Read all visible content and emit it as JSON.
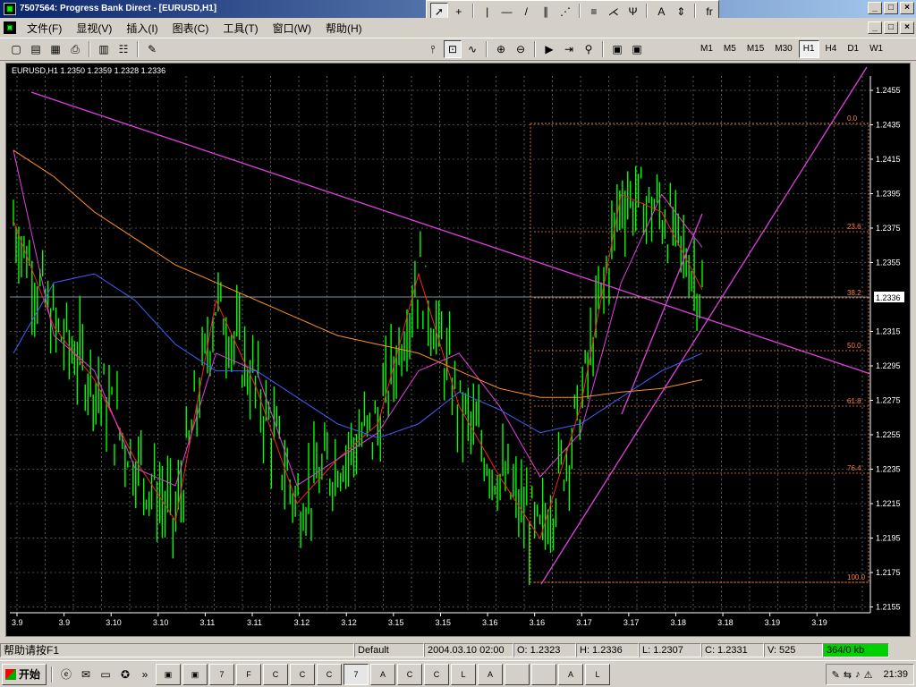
{
  "window": {
    "title": "7507564: Progress Bank Direct - [EURUSD,H1]",
    "btn_min": "_",
    "btn_max": "□",
    "btn_close": "×"
  },
  "menu": [
    "文件(F)",
    "显视(V)",
    "插入(I)",
    "图表(C)",
    "工具(T)",
    "窗口(W)",
    "帮助(H)"
  ],
  "drawing_tools": {
    "text_tool": "A",
    "fib_tool": "fr"
  },
  "timeframes": [
    "M1",
    "M5",
    "M15",
    "M30",
    "H1",
    "H4",
    "D1",
    "W1"
  ],
  "active_timeframe": "H1",
  "chart": {
    "header": "EURUSD,H1  1.2350 1.2359 1.2328 1.2336",
    "current_price": "1.2336",
    "price_labels": [
      "1.2455",
      "1.2435",
      "1.2415",
      "1.2395",
      "1.2375",
      "1.2355",
      "1.2336",
      "1.2315",
      "1.2295",
      "1.2275",
      "1.2255",
      "1.2235",
      "1.2215",
      "1.2195",
      "1.2175",
      "1.2155"
    ],
    "date_labels": [
      "3.9",
      "3.9",
      "3.10",
      "3.10",
      "3.11",
      "3.11",
      "3.12",
      "3.12",
      "3.15",
      "3.15",
      "3.16",
      "3.16",
      "3.17",
      "3.17",
      "3.18",
      "3.18",
      "3.19",
      "3.19"
    ],
    "fib_levels": [
      "0.0",
      "23.6",
      "38.2",
      "50.0",
      "61.8",
      "76.4",
      "100.0"
    ],
    "colors": {
      "bg": "#000000",
      "candle": "#00ff00",
      "grid": "#d0d0d0",
      "trendline": "#e040e0",
      "ma_fast": "#ff2020",
      "ma_mid": "#e040e0",
      "ma_slow": "#4060ff",
      "ma_long": "#ff9020",
      "fib": "#ff8040",
      "price_line": "#8090a0"
    }
  },
  "chart_data": {
    "type": "line",
    "title": "EURUSD,H1  1.2350 1.2359 1.2328 1.2336",
    "xlabel": "",
    "ylabel": "",
    "ylim": [
      1.2155,
      1.2455
    ],
    "categories": [
      "3.9",
      "3.9",
      "3.10",
      "3.10",
      "3.11",
      "3.11",
      "3.12",
      "3.12",
      "3.15",
      "3.15",
      "3.16",
      "3.16",
      "3.17",
      "3.17",
      "3.18",
      "3.18",
      "3.19",
      "3.19"
    ],
    "series": [
      {
        "values": [
          1.2375,
          1.2315,
          1.2285,
          1.224,
          1.2205,
          1.233,
          1.228,
          1.2215,
          1.224,
          1.226,
          1.2345,
          1.227,
          1.223,
          1.2195,
          1.227,
          1.239,
          1.238,
          1.2336
        ]
      },
      {
        "values": [
          1.2415,
          1.231,
          1.229,
          1.2235,
          1.2225,
          1.23,
          1.229,
          1.2225,
          1.224,
          1.2255,
          1.229,
          1.23,
          1.227,
          1.223,
          1.2255,
          1.234,
          1.239,
          1.236
        ]
      },
      {
        "values": [
          1.23,
          1.234,
          1.2345,
          1.233,
          1.2305,
          1.229,
          1.229,
          1.2275,
          1.226,
          1.2252,
          1.226,
          1.2278,
          1.2268,
          1.2255,
          1.226,
          1.2275,
          1.229,
          1.23
        ]
      },
      {
        "values": [
          1.2415,
          1.24,
          1.238,
          1.2365,
          1.235,
          1.234,
          1.233,
          1.232,
          1.231,
          1.2305,
          1.23,
          1.229,
          1.228,
          1.2275,
          1.2275,
          1.2278,
          1.228,
          1.2285
        ]
      }
    ],
    "grid": true
  },
  "status": {
    "help": "帮助请按F1",
    "profile": "Default",
    "time": "2004.03.10 02:00",
    "open": "O: 1.2323",
    "high": "H: 1.2336",
    "low": "L: 1.2307",
    "close": "C: 1.2331",
    "volume": "V: 525",
    "traffic": "364/0 kb"
  },
  "taskbar": {
    "start": "开始",
    "tasks": [
      "7",
      "F",
      "C",
      "C",
      "C",
      "7",
      "A",
      "C",
      "C",
      "L",
      "A",
      "",
      "",
      "A",
      "L"
    ],
    "clock": "21:39"
  }
}
